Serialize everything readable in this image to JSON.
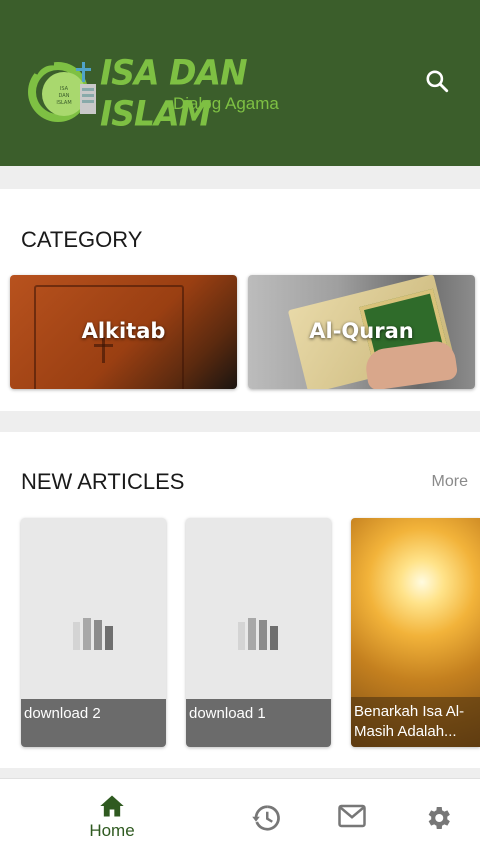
{
  "header": {
    "logo_title": "ISA DAN ISLAM",
    "logo_subtitle": "Dialog Agama",
    "logo_mark_text": [
      "ISA",
      "DAN",
      "ISLAM"
    ],
    "bg_color": "#3b5e2b",
    "accent_color": "#7ec043",
    "search_icon": "search-icon"
  },
  "category": {
    "title": "CATEGORY",
    "items": [
      {
        "label": "Alkitab",
        "icon": "bible-image"
      },
      {
        "label": "Al-Quran",
        "icon": "quran-image"
      }
    ]
  },
  "articles": {
    "title": "NEW ARTICLES",
    "more_label": "More",
    "items": [
      {
        "caption": "download 2",
        "image": "placeholder-image-icon"
      },
      {
        "caption": "download 1",
        "image": "placeholder-image-icon"
      },
      {
        "caption": "Benarkah Isa Al-Masih Adalah...",
        "image": "sunlight-clouds-image"
      }
    ]
  },
  "bottom_nav": {
    "items": [
      {
        "label": "Home",
        "icon": "home-icon",
        "active": true
      },
      {
        "label": "",
        "icon": "history-icon"
      },
      {
        "label": "",
        "icon": "mail-icon"
      },
      {
        "label": "",
        "icon": "settings-icon"
      }
    ],
    "active_color": "#2f5a20",
    "inactive_color": "#777777"
  }
}
